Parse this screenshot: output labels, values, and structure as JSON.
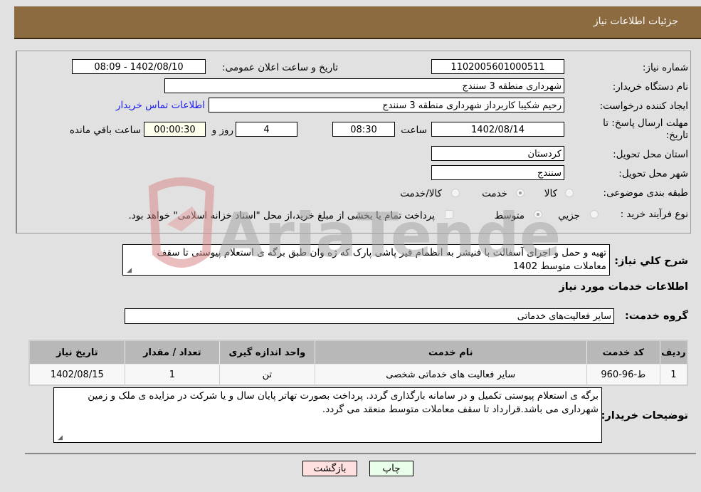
{
  "header": {
    "title": "جزئیات اطلاعات نیاز"
  },
  "form": {
    "need_number": {
      "label": "شماره نیاز:",
      "value": "1102005601000511"
    },
    "announce_datetime": {
      "label": "تاریخ و ساعت اعلان عمومی:",
      "value": "1402/08/10 - 08:09"
    },
    "buyer_org": {
      "label": "نام دستگاه خریدار:",
      "value": "شهرداری منطقه 3 سنندج"
    },
    "requester": {
      "label": "ایجاد کننده درخواست:",
      "value": "رحیم شکیبا کاربرداز شهرداری منطقه 3 سنندج",
      "contact_link": "اطلاعات تماس خریدار"
    },
    "deadline": {
      "label": "مهلت ارسال پاسخ: تا تاریخ:",
      "date": "1402/08/14",
      "time_label": "ساعت",
      "time": "08:30",
      "days": "4",
      "days_label": "روز و",
      "remaining": "00:00:30",
      "remaining_label": "ساعت باقي مانده"
    },
    "province": {
      "label": "استان محل تحویل:",
      "value": "کردستان"
    },
    "city": {
      "label": "شهر محل تحویل:",
      "value": "سنندج"
    },
    "category": {
      "label": "طبقه بندی موضوعی:",
      "options": [
        "کالا",
        "خدمت",
        "کالا/خدمت"
      ],
      "selected": "خدمت"
    },
    "purchase_type": {
      "label": "نوع فرآیند خرید :",
      "options": [
        "جزيي",
        "متوسط"
      ],
      "selected": "متوسط",
      "treasury_note": "پرداخت تمام یا بخشی از مبلغ خرید،از محل \"اسناد خزانه اسلامی\" خواهد بود."
    }
  },
  "description": {
    "label": "شرح كلي نياز:",
    "value": "تهیه و حمل و اجرای آسفالت با فنیشر به انظمام قیر پاشی پارک که ژه وان طبق برگه ی استعلام پیوستی تا سقف معاملات متوسط 1402"
  },
  "services_section": {
    "title": "اطلاعات خدمات مورد نیاز"
  },
  "service_group": {
    "label": "گروه خدمت:",
    "value": "سایر فعالیت‌های خدماتی"
  },
  "table": {
    "headers": [
      "ردیف",
      "کد خدمت",
      "نام خدمت",
      "واحد اندازه گیری",
      "تعداد / مقدار",
      "تاریخ نیاز"
    ],
    "rows": [
      [
        "1",
        "ط-96-960",
        "سایر فعالیت های خدماتی شخصی",
        "تن",
        "1",
        "1402/08/15"
      ]
    ]
  },
  "buyer_notes": {
    "label": "توضیحات خریدار:",
    "value": "برگه ی استعلام پیوستی تکمیل و در سامانه بارگذاری گردد. پرداخت بصورت تهاتر پایان سال و یا شرکت در مزایده ی ملک و زمین شهرداری می باشد.قرارداد تا سقف معاملات متوسط منعقد می گردد."
  },
  "buttons": {
    "print": "چاپ",
    "back": "بازگشت"
  },
  "watermark": {
    "text": "AriaTender.neT"
  },
  "colors": {
    "header_bg": "#8d6b41",
    "print_bg": "#eaffea",
    "back_bg": "#ffe0e0",
    "link": "#1a1aee"
  }
}
